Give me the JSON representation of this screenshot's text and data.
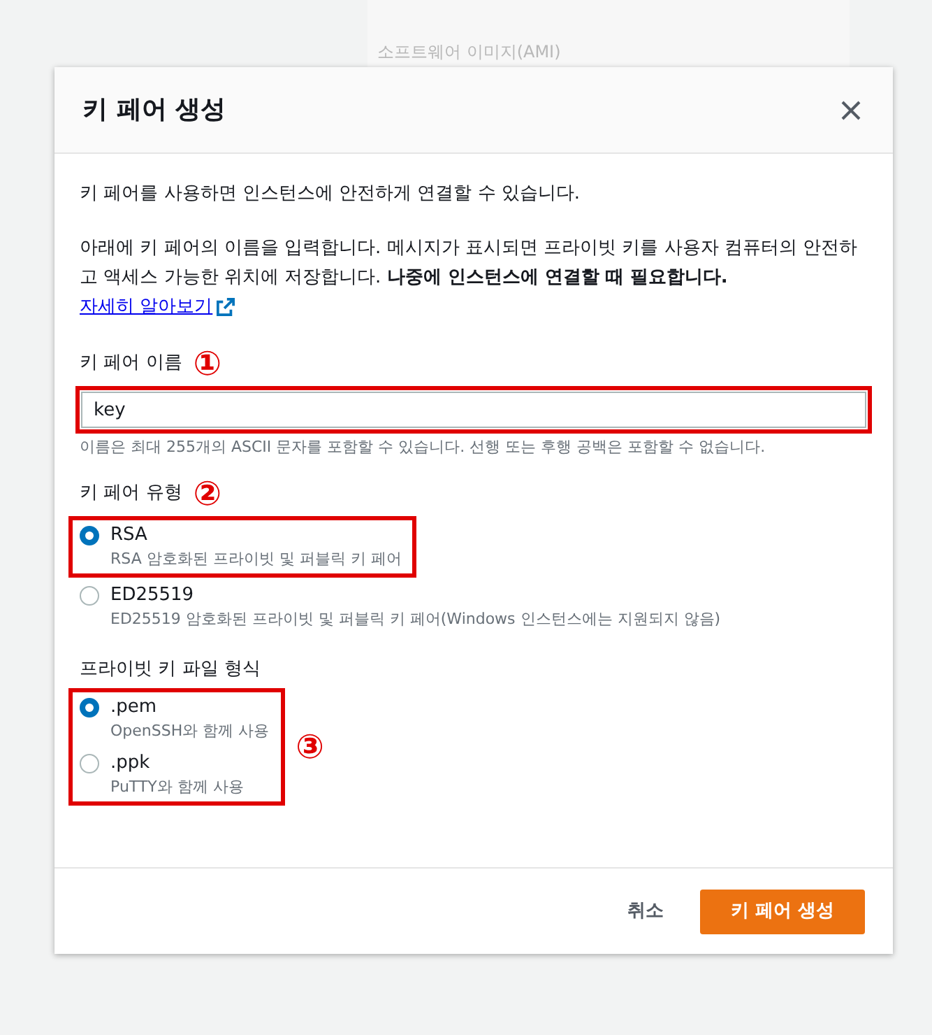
{
  "background": {
    "label": "소프트웨어 이미지(AMI)"
  },
  "dialog": {
    "title": "키 페어 생성",
    "intro": "키 페어를 사용하면 인스턴스에 안전하게 연결할 수 있습니다.",
    "description": "아래에 키 페어의 이름을 입력합니다. 메시지가 표시되면 프라이빗 키를 사용자 컴퓨터의 안전하고 액세스 가능한 위치에 저장합니다. **나중에 인스턴스에 연결할 때 필요합니다.**",
    "learn_more": "자세히 알아보기",
    "name_field": {
      "label": "키 페어 이름",
      "marker": "①",
      "value": "key",
      "hint": "이름은 최대 255개의 ASCII 문자를 포함할 수 있습니다. 선행 또는 후행 공백은 포함할 수 없습니다."
    },
    "key_type": {
      "label": "키 페어 유형",
      "marker": "②",
      "options": [
        {
          "label": "RSA",
          "description": "RSA 암호화된 프라이빗 및 퍼블릭 키 페어",
          "selected": true
        },
        {
          "label": "ED25519",
          "description": "ED25519 암호화된 프라이빗 및 퍼블릭 키 페어(Windows 인스턴스에는 지원되지 않음)",
          "selected": false
        }
      ]
    },
    "file_format": {
      "label": "프라이빗 키 파일 형식",
      "marker": "③",
      "options": [
        {
          "label": ".pem",
          "description": "OpenSSH와 함께 사용",
          "selected": true
        },
        {
          "label": ".ppk",
          "description": "PuTTY와 함께 사용",
          "selected": false
        }
      ]
    },
    "buttons": [
      {
        "label": "취소",
        "kind": "secondary"
      },
      {
        "label": "키 페어 생성",
        "kind": "primary"
      }
    ]
  }
}
